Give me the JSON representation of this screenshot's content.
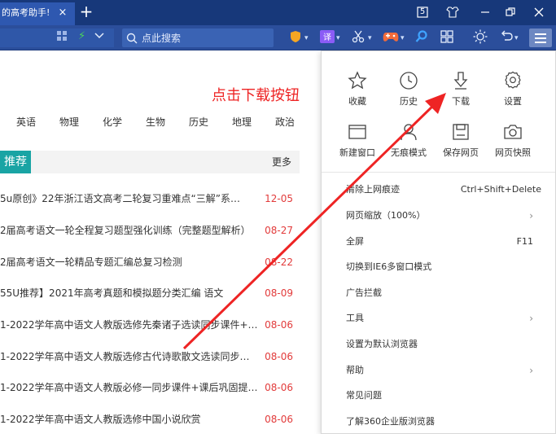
{
  "titlebar": {
    "tab_title": "的高考助手!",
    "tab_close": "×",
    "new_tab": "+",
    "badge": "5"
  },
  "toolbar": {
    "search_placeholder": "点此搜索"
  },
  "subjects": [
    "英语",
    "物理",
    "化学",
    "生物",
    "历史",
    "地理",
    "政治"
  ],
  "section": {
    "tab_label": "推荐",
    "more_label": "更多"
  },
  "articles": [
    {
      "title": "5u原创》22年浙江语文高考二轮复习重难点“三解”系…",
      "date": "12-05"
    },
    {
      "title": "2届高考语文一轮全程复习题型强化训练（完整题型解析）",
      "date": "08-27"
    },
    {
      "title": "2届高考语文一轮精品专题汇编总复习检测",
      "date": "08-22"
    },
    {
      "title": "55U推荐】2021年高考真题和模拟题分类汇编 语文",
      "date": "08-09"
    },
    {
      "title": "1-2022学年高中语文人教版选修先秦诸子选读同步课件+…",
      "date": "08-06"
    },
    {
      "title": "1-2022学年高中语文人教版选修古代诗歌散文选读同步…",
      "date": "08-06"
    },
    {
      "title": "1-2022学年高中语文人教版必修一同步课件+课后巩固提…",
      "date": "08-06"
    },
    {
      "title": "1-2022学年高中语文人教版选修中国小说欣赏",
      "date": "08-06"
    }
  ],
  "menu": {
    "grid": [
      {
        "label": "收藏",
        "icon": "star-icon"
      },
      {
        "label": "历史",
        "icon": "clock-icon"
      },
      {
        "label": "下载",
        "icon": "download-icon"
      },
      {
        "label": "设置",
        "icon": "gear-icon"
      },
      {
        "label": "新建窗口",
        "icon": "window-icon"
      },
      {
        "label": "无痕模式",
        "icon": "incognito-icon"
      },
      {
        "label": "保存网页",
        "icon": "save-icon"
      },
      {
        "label": "网页快照",
        "icon": "camera-icon"
      }
    ],
    "items": [
      {
        "label": "清除上网痕迹",
        "shortcut": "Ctrl+Shift+Delete"
      },
      {
        "label": "网页缩放（100%）",
        "submenu": "›"
      },
      {
        "label": "全屏",
        "shortcut": "F11"
      },
      {
        "label": "切换到IE6多窗口模式"
      },
      {
        "label": "广告拦截"
      },
      {
        "label": "工具",
        "submenu": "›"
      },
      {
        "label": "设置为默认浏览器"
      },
      {
        "label": "帮助",
        "submenu": "›"
      },
      {
        "label": "常见问题"
      },
      {
        "label": "了解360企业版浏览器"
      }
    ]
  },
  "annotation": {
    "text": "点击下载按钮",
    "color": "#ee2424"
  }
}
